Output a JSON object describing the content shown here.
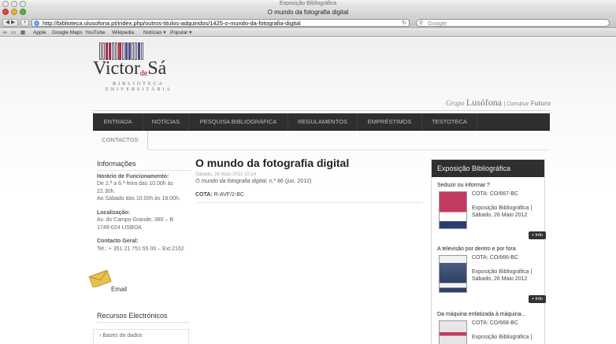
{
  "window": {
    "tab_title": "Exposição Bibliográfica",
    "page_title": "O mundo da fotografia digital"
  },
  "toolbar": {
    "url": "http://biblioteca.ulusofona.pt/index.php/outros-titulos-adquiridos/1425-o-mundo-da-fotografia-digital",
    "search_placeholder": "Google",
    "reload_icon": "reload-icon"
  },
  "bookmarks": [
    "Apple",
    "Google Maps",
    "YouTube",
    "Wikipedia",
    "Notícias ▾",
    "Popular ▾"
  ],
  "logo": {
    "name_left": "Victor",
    "name_mid": "de",
    "name_right": "Sá",
    "sub1": "BIBLIOTECA",
    "sub2": "UNIVERSITÁRIA"
  },
  "grupo": {
    "grupo": "Grupo",
    "lusofona": "Lusófona",
    "construir": "Construir",
    "futuro": "Futuro"
  },
  "nav": [
    "ENTRADA",
    "NOTÍCIAS",
    "PESQUISA BIBLIOGRÁFICA",
    "REGULAMENTOS",
    "EMPRÉSTIMOS",
    "TESTOTECA"
  ],
  "nav_second": "CONTACTOS",
  "info": {
    "title": "Informações",
    "horario_label": "Horário de Funcionamento:",
    "horario_1": "De 2.ª a 6.ª feira das 10.00h às 22.30h.",
    "horario_2": "Ao Sábado das 10.00h às 18.00h.",
    "loc_label": "Localização:",
    "loc_1": "Av. do Campo Grande, 380 – B",
    "loc_2": "1749-024 LISBOA",
    "contact_label": "Contacto Geral:",
    "contact_1": "Tel.: + 351 21 751 55 00 – Ext.2162",
    "email": "Email",
    "recursos": "Recursos Electrónicos",
    "bases": "› Bases de dados"
  },
  "article": {
    "title": "O mundo da fotografia digital",
    "date": "Sábado, 26 Maio 2012 10:14",
    "source_italic": "O mundo da fotografia digital",
    "source_rest": ", n.º 86 (jun. 2012)",
    "cota_label": "COTA:",
    "cota_value": " R-AVF/2-BC"
  },
  "sidebar": {
    "title": "Exposição Bibliográfica",
    "items": [
      {
        "title": "Seduzir ou informar ?",
        "cota": "COTA: CO/667-BC",
        "exp": "Exposição Bibliográfica |",
        "date": "Sábado, 26 Maio 2012",
        "info": "+ Info",
        "cover_color": "#c43b62"
      },
      {
        "title": "A televisão por dentro e por fora",
        "cota": "COTA: CO/666-BC",
        "exp": "Exposição Bibliográfica |",
        "date": "Sábado, 26 Maio 2012",
        "info": "+ Info",
        "cover_color": "#2f3f66"
      },
      {
        "title": "Da máquina enfatizada à máquina...",
        "cota": "COTA: CO/668-BC",
        "exp": "Exposição Bibliográfica |",
        "date": "",
        "info": "",
        "cover_color": "#e6e6e6"
      }
    ]
  }
}
